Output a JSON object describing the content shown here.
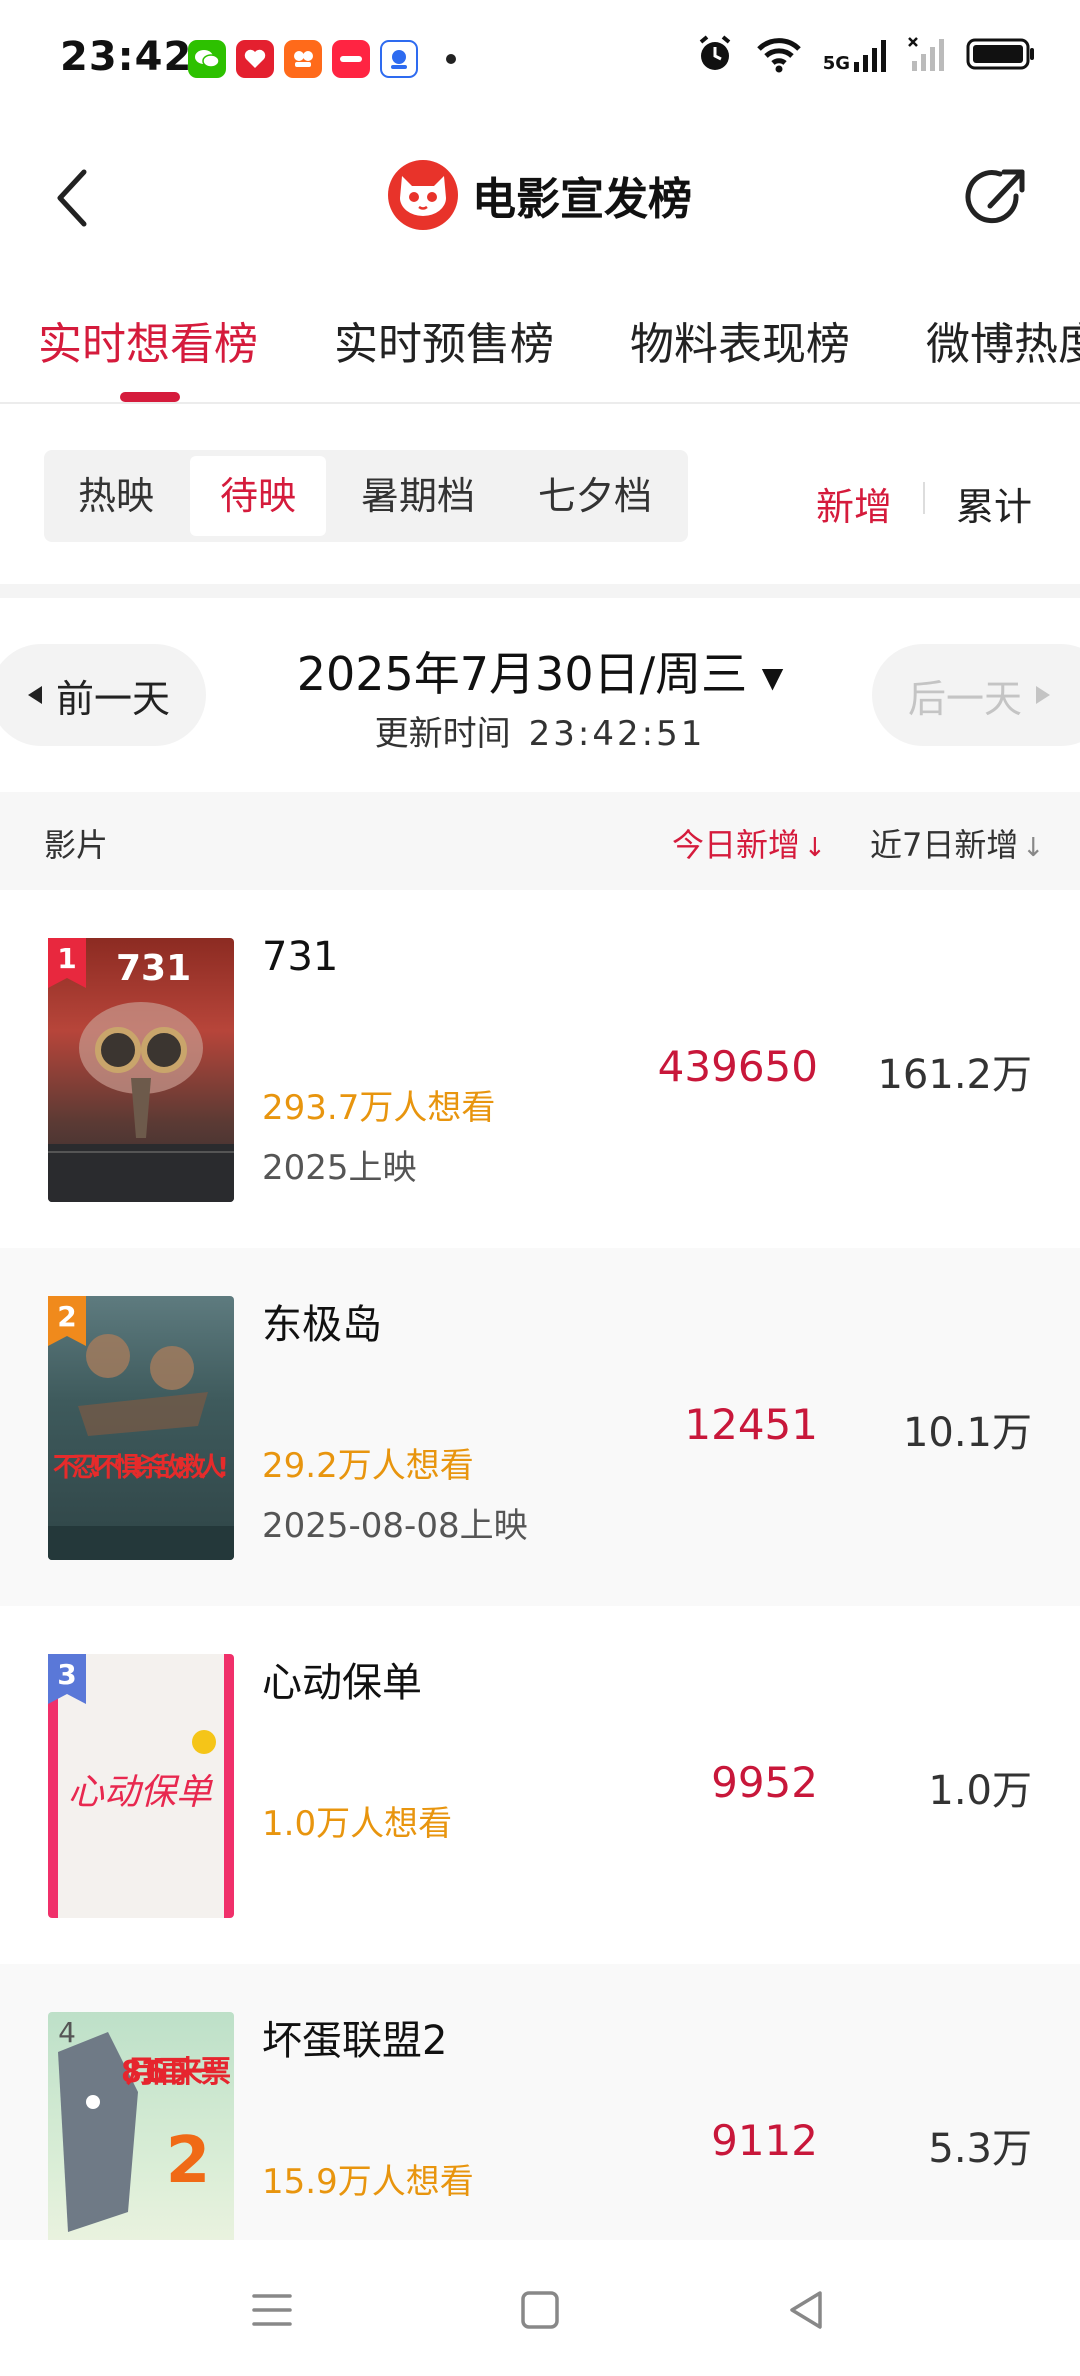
{
  "status_bar": {
    "time": "23:42",
    "network": "5G"
  },
  "header": {
    "title": "电影宣发榜"
  },
  "tabs": [
    {
      "label": "实时想看榜"
    },
    {
      "label": "实时预售榜"
    },
    {
      "label": "物料表现榜"
    },
    {
      "label": "微博热度"
    }
  ],
  "segments": [
    {
      "label": "热映"
    },
    {
      "label": "待映"
    },
    {
      "label": "暑期档"
    },
    {
      "label": "七夕档"
    }
  ],
  "modes": {
    "new": "新增",
    "total": "累计"
  },
  "date_nav": {
    "prev": "前一天",
    "next": "后一天",
    "date": "2025年7月30日/周三",
    "update_label": "更新时间",
    "update_time": "23:42:51"
  },
  "columns": {
    "film": "影片",
    "today": "今日新增",
    "week": "近7日新增"
  },
  "colors": {
    "accent": "#d51b3c",
    "want": "#e8950e"
  },
  "movies": [
    {
      "rank": "1",
      "title": "731",
      "want": "293.7万人想看",
      "release": "2025上映",
      "today": "439650",
      "week": "161.2万",
      "poster_text": "731"
    },
    {
      "rank": "2",
      "title": "东极岛",
      "want": "29.2万人想看",
      "release": "2025-08-08上映",
      "today": "12451",
      "week": "10.1万",
      "poster_text": "不忍!不惧!杀敌!救人!"
    },
    {
      "rank": "3",
      "title": "心动保单",
      "want": "1.0万人想看",
      "release": "",
      "today": "9952",
      "week": "1.0万",
      "poster_text": "心动保单"
    },
    {
      "rank": "4",
      "title": "坏蛋联盟2",
      "want": "15.9万人想看",
      "release": "",
      "today": "9112",
      "week": "5.3万",
      "poster_text": "8月16日 再来一票"
    }
  ]
}
